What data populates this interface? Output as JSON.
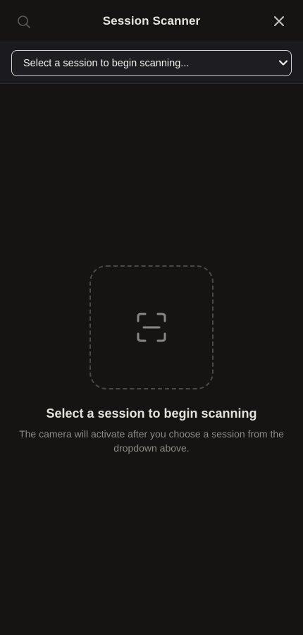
{
  "header": {
    "title": "Session Scanner",
    "search_icon": "search-icon",
    "close_icon": "close-icon"
  },
  "session_select": {
    "selected_label": "Select a session to begin scanning..."
  },
  "empty_state": {
    "icon": "scan-frame-icon",
    "title": "Select a session to begin scanning",
    "description": "The camera will activate after you choose a session from the dropdown above."
  },
  "colors": {
    "background": "#161412",
    "select_bar": "#1b1a1f",
    "text_primary": "#e6e3df",
    "text_muted": "#8d8985",
    "dashed_border": "#4a4744"
  }
}
